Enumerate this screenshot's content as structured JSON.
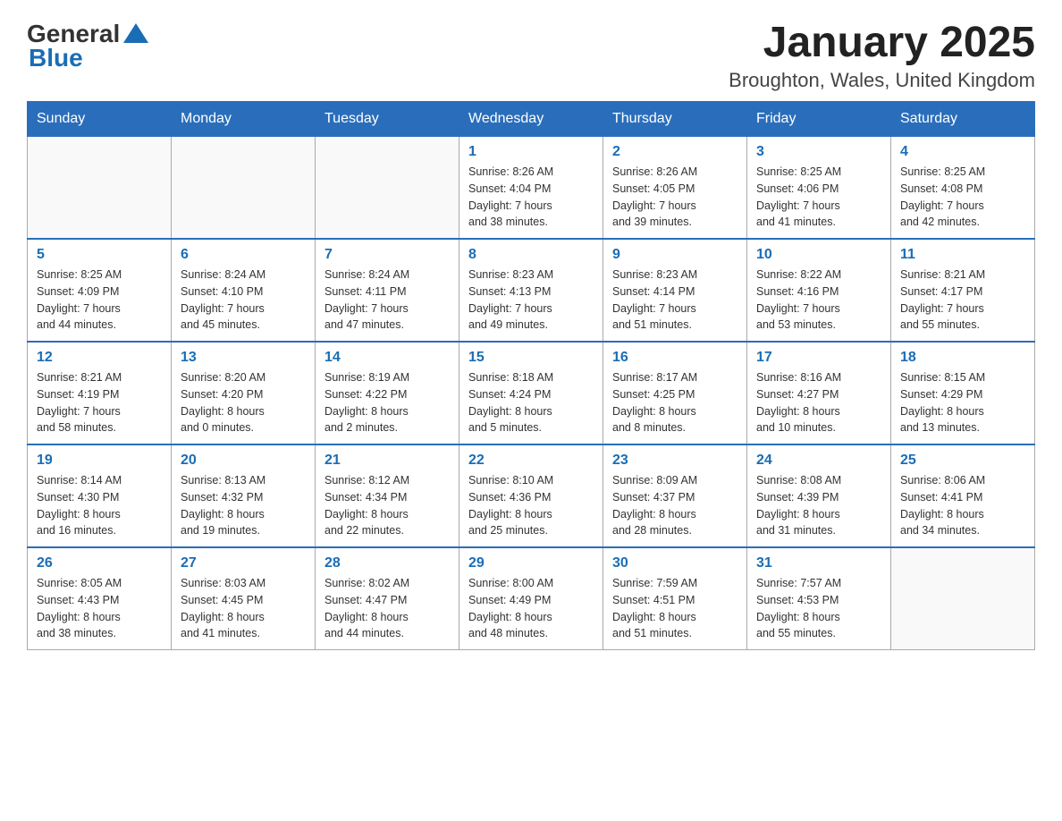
{
  "header": {
    "logo_text_general": "General",
    "logo_text_blue": "Blue",
    "month_title": "January 2025",
    "location": "Broughton, Wales, United Kingdom"
  },
  "weekdays": [
    "Sunday",
    "Monday",
    "Tuesday",
    "Wednesday",
    "Thursday",
    "Friday",
    "Saturday"
  ],
  "weeks": [
    [
      {
        "day": "",
        "info": ""
      },
      {
        "day": "",
        "info": ""
      },
      {
        "day": "",
        "info": ""
      },
      {
        "day": "1",
        "info": "Sunrise: 8:26 AM\nSunset: 4:04 PM\nDaylight: 7 hours\nand 38 minutes."
      },
      {
        "day": "2",
        "info": "Sunrise: 8:26 AM\nSunset: 4:05 PM\nDaylight: 7 hours\nand 39 minutes."
      },
      {
        "day": "3",
        "info": "Sunrise: 8:25 AM\nSunset: 4:06 PM\nDaylight: 7 hours\nand 41 minutes."
      },
      {
        "day": "4",
        "info": "Sunrise: 8:25 AM\nSunset: 4:08 PM\nDaylight: 7 hours\nand 42 minutes."
      }
    ],
    [
      {
        "day": "5",
        "info": "Sunrise: 8:25 AM\nSunset: 4:09 PM\nDaylight: 7 hours\nand 44 minutes."
      },
      {
        "day": "6",
        "info": "Sunrise: 8:24 AM\nSunset: 4:10 PM\nDaylight: 7 hours\nand 45 minutes."
      },
      {
        "day": "7",
        "info": "Sunrise: 8:24 AM\nSunset: 4:11 PM\nDaylight: 7 hours\nand 47 minutes."
      },
      {
        "day": "8",
        "info": "Sunrise: 8:23 AM\nSunset: 4:13 PM\nDaylight: 7 hours\nand 49 minutes."
      },
      {
        "day": "9",
        "info": "Sunrise: 8:23 AM\nSunset: 4:14 PM\nDaylight: 7 hours\nand 51 minutes."
      },
      {
        "day": "10",
        "info": "Sunrise: 8:22 AM\nSunset: 4:16 PM\nDaylight: 7 hours\nand 53 minutes."
      },
      {
        "day": "11",
        "info": "Sunrise: 8:21 AM\nSunset: 4:17 PM\nDaylight: 7 hours\nand 55 minutes."
      }
    ],
    [
      {
        "day": "12",
        "info": "Sunrise: 8:21 AM\nSunset: 4:19 PM\nDaylight: 7 hours\nand 58 minutes."
      },
      {
        "day": "13",
        "info": "Sunrise: 8:20 AM\nSunset: 4:20 PM\nDaylight: 8 hours\nand 0 minutes."
      },
      {
        "day": "14",
        "info": "Sunrise: 8:19 AM\nSunset: 4:22 PM\nDaylight: 8 hours\nand 2 minutes."
      },
      {
        "day": "15",
        "info": "Sunrise: 8:18 AM\nSunset: 4:24 PM\nDaylight: 8 hours\nand 5 minutes."
      },
      {
        "day": "16",
        "info": "Sunrise: 8:17 AM\nSunset: 4:25 PM\nDaylight: 8 hours\nand 8 minutes."
      },
      {
        "day": "17",
        "info": "Sunrise: 8:16 AM\nSunset: 4:27 PM\nDaylight: 8 hours\nand 10 minutes."
      },
      {
        "day": "18",
        "info": "Sunrise: 8:15 AM\nSunset: 4:29 PM\nDaylight: 8 hours\nand 13 minutes."
      }
    ],
    [
      {
        "day": "19",
        "info": "Sunrise: 8:14 AM\nSunset: 4:30 PM\nDaylight: 8 hours\nand 16 minutes."
      },
      {
        "day": "20",
        "info": "Sunrise: 8:13 AM\nSunset: 4:32 PM\nDaylight: 8 hours\nand 19 minutes."
      },
      {
        "day": "21",
        "info": "Sunrise: 8:12 AM\nSunset: 4:34 PM\nDaylight: 8 hours\nand 22 minutes."
      },
      {
        "day": "22",
        "info": "Sunrise: 8:10 AM\nSunset: 4:36 PM\nDaylight: 8 hours\nand 25 minutes."
      },
      {
        "day": "23",
        "info": "Sunrise: 8:09 AM\nSunset: 4:37 PM\nDaylight: 8 hours\nand 28 minutes."
      },
      {
        "day": "24",
        "info": "Sunrise: 8:08 AM\nSunset: 4:39 PM\nDaylight: 8 hours\nand 31 minutes."
      },
      {
        "day": "25",
        "info": "Sunrise: 8:06 AM\nSunset: 4:41 PM\nDaylight: 8 hours\nand 34 minutes."
      }
    ],
    [
      {
        "day": "26",
        "info": "Sunrise: 8:05 AM\nSunset: 4:43 PM\nDaylight: 8 hours\nand 38 minutes."
      },
      {
        "day": "27",
        "info": "Sunrise: 8:03 AM\nSunset: 4:45 PM\nDaylight: 8 hours\nand 41 minutes."
      },
      {
        "day": "28",
        "info": "Sunrise: 8:02 AM\nSunset: 4:47 PM\nDaylight: 8 hours\nand 44 minutes."
      },
      {
        "day": "29",
        "info": "Sunrise: 8:00 AM\nSunset: 4:49 PM\nDaylight: 8 hours\nand 48 minutes."
      },
      {
        "day": "30",
        "info": "Sunrise: 7:59 AM\nSunset: 4:51 PM\nDaylight: 8 hours\nand 51 minutes."
      },
      {
        "day": "31",
        "info": "Sunrise: 7:57 AM\nSunset: 4:53 PM\nDaylight: 8 hours\nand 55 minutes."
      },
      {
        "day": "",
        "info": ""
      }
    ]
  ]
}
